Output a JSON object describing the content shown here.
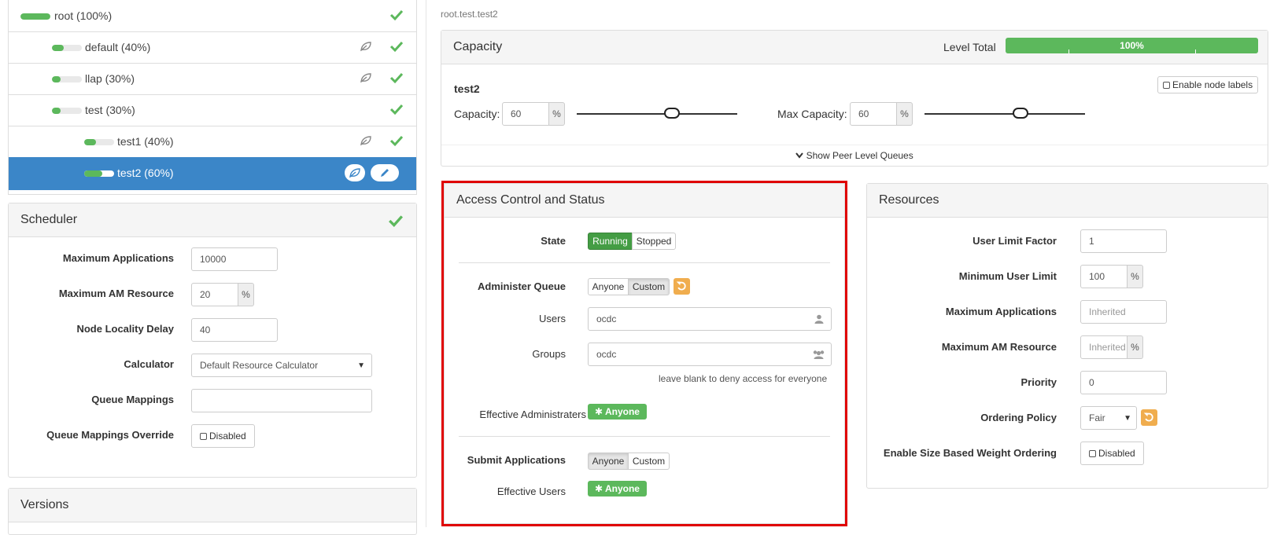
{
  "queues": [
    {
      "label": "root (100%)",
      "fill": 1.0
    },
    {
      "label": "default (40%)",
      "fill": 0.4
    },
    {
      "label": "llap (30%)",
      "fill": 0.3
    },
    {
      "label": "test (30%)",
      "fill": 0.3
    },
    {
      "label": "test1 (40%)",
      "fill": 0.4
    },
    {
      "label": "test2 (60%)",
      "fill": 0.6
    }
  ],
  "scheduler": {
    "title": "Scheduler",
    "max_apps_label": "Maximum Applications",
    "max_apps_value": "10000",
    "max_am_label": "Maximum AM Resource",
    "max_am_value": "20",
    "percent": "%",
    "node_locality_label": "Node Locality Delay",
    "node_locality_value": "40",
    "calculator_label": "Calculator",
    "calculator_value": "Default Resource Calculator",
    "queue_mappings_label": "Queue Mappings",
    "queue_mappings_value": "",
    "override_label": "Queue Mappings Override",
    "override_value": "Disabled"
  },
  "versions": {
    "title": "Versions"
  },
  "breadcrumb": "root.test.test2",
  "capacity": {
    "title": "Capacity",
    "level_total_label": "Level Total",
    "level_total_value": "100%",
    "queue_name": "test2",
    "capacity_label": "Capacity:",
    "capacity_value": "60",
    "max_capacity_label": "Max Capacity:",
    "max_capacity_value": "60",
    "percent": "%",
    "enable_node_labels": "Enable node labels",
    "show_peer": "Show Peer Level Queues"
  },
  "access": {
    "title": "Access Control and Status",
    "state_label": "State",
    "running": "Running",
    "stopped": "Stopped",
    "administer_label": "Administer Queue",
    "anyone": "Anyone",
    "custom": "Custom",
    "users_label": "Users",
    "users_value": "ocdc",
    "groups_label": "Groups",
    "groups_value": "ocdc",
    "hint": "leave blank to deny access for everyone",
    "effective_admins_label": "Effective Administraters",
    "effective_admins_value": "Anyone",
    "submit_label": "Submit Applications",
    "submit_anyone": "Anyone",
    "submit_custom": "Custom",
    "effective_users_label": "Effective Users",
    "effective_users_value": "Anyone"
  },
  "resources": {
    "title": "Resources",
    "user_limit_label": "User Limit Factor",
    "user_limit_value": "1",
    "min_user_label": "Minimum User Limit",
    "min_user_value": "100",
    "percent": "%",
    "max_apps_label": "Maximum Applications",
    "max_apps_placeholder": "Inherited",
    "max_am_label": "Maximum AM Resource",
    "max_am_placeholder": "Inherited",
    "priority_label": "Priority",
    "priority_value": "0",
    "ordering_label": "Ordering Policy",
    "ordering_value": "Fair",
    "size_weight_label": "Enable Size Based Weight Ordering",
    "size_weight_value": "Disabled"
  },
  "colors": {
    "accent": "#3b86c8",
    "success": "#5cb85c",
    "warning": "#f0ad4e",
    "highlight": "#e00000"
  },
  "icons": [
    "check-icon",
    "leaf-icon",
    "pencil-icon",
    "user-icon",
    "users-icon",
    "undo-icon",
    "chevron-down-icon",
    "asterisk-icon"
  ]
}
